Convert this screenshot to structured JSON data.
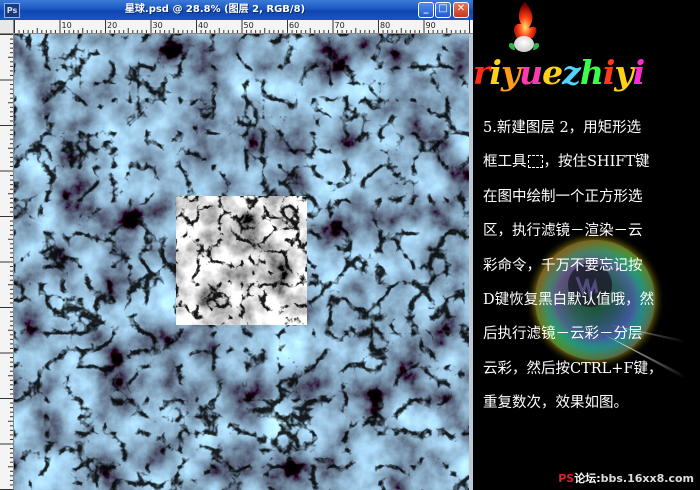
{
  "document": {
    "title": "星球.psd @ 28.8% (图层 2, RGB/8)",
    "app_icon": "photoshop-icon",
    "window_buttons": [
      "_",
      "□",
      "✕"
    ],
    "ruler_labels": [
      "10",
      "20",
      "30",
      "40",
      "50",
      "60",
      "70",
      "80",
      "90"
    ]
  },
  "tutorial": {
    "logo_letters": [
      "r",
      "i",
      "y",
      "u",
      "e",
      "z",
      "h",
      "i",
      "y",
      "i"
    ],
    "logo_colors": [
      "#ff2a1a",
      "#ffd21a",
      "#ff9a1a",
      "#ff3ab0",
      "#ffd21a",
      "#4fd5ff",
      "#3cff4a",
      "#ff3a1a",
      "#ffd21a",
      "#ff2ad0"
    ],
    "lines": [
      {
        "pre": "5.新建图层 2，用矩形选",
        "post": ""
      },
      {
        "pre": "框工具",
        "post": "，按住SHIFT键",
        "icon": "rectangle-marquee-tool-icon"
      },
      {
        "pre": "在图中绘制一个正方形选",
        "post": ""
      },
      {
        "pre": "区，执行滤镜－渲染－云",
        "post": ""
      },
      {
        "pre": "彩命令，千万不要忘记按",
        "post": ""
      },
      {
        "pre": "D键恢复黑白默认值哦，然",
        "post": ""
      },
      {
        "pre": "后执行滤镜－云彩－分层",
        "post": ""
      },
      {
        "pre": "云彩，然后按CTRL+F键，",
        "post": ""
      },
      {
        "pre": "重复数次，效果如图。",
        "post": ""
      }
    ],
    "watermark": {
      "ps": "PS",
      "lt": "论坛:",
      "site": "bbs.16xx8.com"
    }
  },
  "colors": {
    "titlebar": "#1b57c4",
    "canvas_base": "#0e2030",
    "cloud_tint": "#2f6c93"
  }
}
